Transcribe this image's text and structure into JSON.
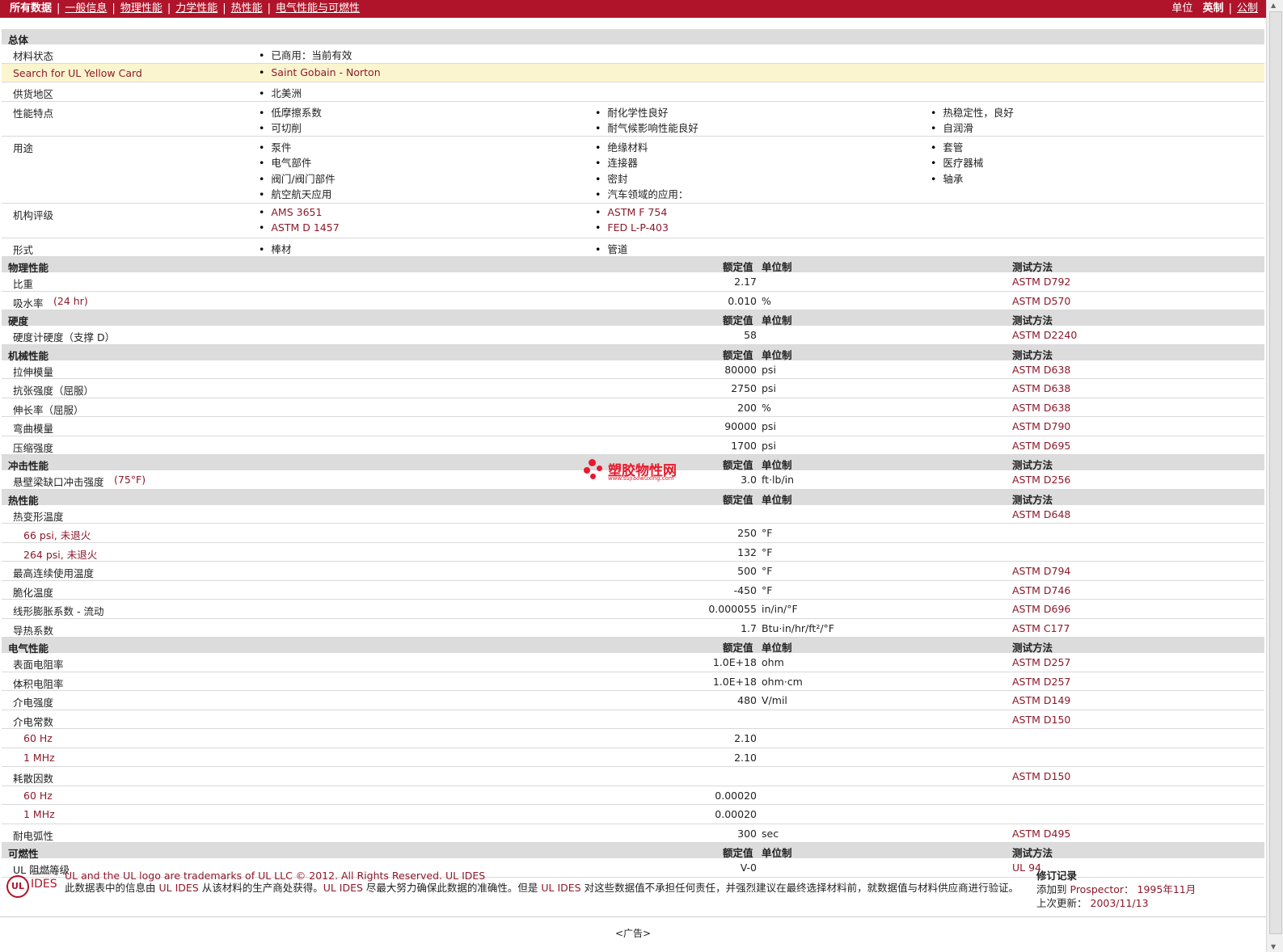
{
  "nav": {
    "current": "所有数据",
    "links": [
      "一般信息",
      "物理性能",
      "力学性能",
      "热性能",
      "电气性能与可燃性"
    ],
    "units_label": "单位",
    "units_current": "英制",
    "units_other": "公制"
  },
  "general": {
    "section_title": "总体",
    "material_status": {
      "label": "材料状态",
      "value": "已商用：当前有效"
    },
    "yellow_card": {
      "label": "Search for UL Yellow Card",
      "value": "Saint Gobain - Norton"
    },
    "region": {
      "label": "供货地区",
      "value": "北美洲"
    },
    "features": {
      "label": "性能特点",
      "col1": [
        "低摩擦系数",
        "可切削"
      ],
      "col2": [
        "耐化学性良好",
        "耐气候影响性能良好"
      ],
      "col3": [
        "热稳定性，良好",
        "自润滑"
      ]
    },
    "uses": {
      "label": "用途",
      "col1": [
        "泵件",
        "电气部件",
        "阀门/阀门部件",
        "航空航天应用"
      ],
      "col2": [
        "绝缘材料",
        "连接器",
        "密封",
        "汽车领域的应用："
      ],
      "col3": [
        "套管",
        "医疗器械",
        "轴承"
      ]
    },
    "agency": {
      "label": "机构评级",
      "col1": [
        "AMS 3651",
        "ASTM D 1457"
      ],
      "col2": [
        "ASTM F 754",
        "FED L-P-403"
      ]
    },
    "forms": {
      "label": "形式",
      "col1": [
        "棒材"
      ],
      "col2": [
        "管道"
      ]
    }
  },
  "headers": {
    "nominal": "额定值",
    "unit": "单位制",
    "test": "测试方法"
  },
  "sections": {
    "physical": "物理性能",
    "hardness": "硬度",
    "mechanical": "机械性能",
    "impact": "冲击性能",
    "thermal": "热性能",
    "electrical": "电气性能",
    "flammability": "可燃性"
  },
  "physical": [
    {
      "label": "比重",
      "cond": "",
      "value": "2.17",
      "unit": "",
      "test": "ASTM D792"
    },
    {
      "label": "吸水率",
      "cond": "(24 hr)",
      "value": "0.010",
      "unit": "%",
      "test": "ASTM D570"
    }
  ],
  "hardness": [
    {
      "label": "硬度计硬度（支撑 D）",
      "cond": "",
      "value": "58",
      "unit": "",
      "test": "ASTM D2240"
    }
  ],
  "mechanical": [
    {
      "label": "拉伸模量",
      "value": "80000",
      "unit": "psi",
      "test": "ASTM D638"
    },
    {
      "label": "抗张强度（屈服）",
      "value": "2750",
      "unit": "psi",
      "test": "ASTM D638"
    },
    {
      "label": "伸长率（屈服）",
      "value": "200",
      "unit": "%",
      "test": "ASTM D638"
    },
    {
      "label": "弯曲模量",
      "value": "90000",
      "unit": "psi",
      "test": "ASTM D790"
    },
    {
      "label": "压缩强度",
      "value": "1700",
      "unit": "psi",
      "test": "ASTM D695"
    }
  ],
  "impact": [
    {
      "label": "悬壁梁缺口冲击强度",
      "cond": "(75°F)",
      "value": "3.0",
      "unit": "ft·lb/in",
      "test": "ASTM D256"
    }
  ],
  "thermal": [
    {
      "label": "热变形温度",
      "indent": false,
      "value": "",
      "unit": "",
      "test": "ASTM D648"
    },
    {
      "label": "66 psi, 未退火",
      "indent": true,
      "value": "250",
      "unit": "°F",
      "test": ""
    },
    {
      "label": "264 psi, 未退火",
      "indent": true,
      "value": "132",
      "unit": "°F",
      "test": ""
    },
    {
      "label": "最高连续使用温度",
      "indent": false,
      "value": "500",
      "unit": "°F",
      "test": "ASTM D794"
    },
    {
      "label": "脆化温度",
      "indent": false,
      "value": "-450",
      "unit": "°F",
      "test": "ASTM D746"
    },
    {
      "label": "线形膨胀系数 - 流动",
      "indent": false,
      "value": "0.000055",
      "unit": "in/in/°F",
      "test": "ASTM D696"
    },
    {
      "label": "导热系数",
      "indent": false,
      "value": "1.7",
      "unit": "Btu·in/hr/ft²/°F",
      "test": "ASTM C177"
    }
  ],
  "electrical": [
    {
      "label": "表面电阻率",
      "indent": false,
      "value": "1.0E+18",
      "unit": "ohm",
      "test": "ASTM D257"
    },
    {
      "label": "体积电阻率",
      "indent": false,
      "value": "1.0E+18",
      "unit": "ohm·cm",
      "test": "ASTM D257"
    },
    {
      "label": "介电强度",
      "indent": false,
      "value": "480",
      "unit": "V/mil",
      "test": "ASTM D149"
    },
    {
      "label": "介电常数",
      "indent": false,
      "value": "",
      "unit": "",
      "test": "ASTM D150"
    },
    {
      "label": "60 Hz",
      "indent": true,
      "value": "2.10",
      "unit": "",
      "test": ""
    },
    {
      "label": "1 MHz",
      "indent": true,
      "value": "2.10",
      "unit": "",
      "test": ""
    },
    {
      "label": "耗散因数",
      "indent": false,
      "value": "",
      "unit": "",
      "test": "ASTM D150"
    },
    {
      "label": "60 Hz",
      "indent": true,
      "value": "0.00020",
      "unit": "",
      "test": ""
    },
    {
      "label": "1 MHz",
      "indent": true,
      "value": "0.00020",
      "unit": "",
      "test": ""
    },
    {
      "label": "耐电弧性",
      "indent": false,
      "value": "300",
      "unit": "sec",
      "test": "ASTM D495"
    }
  ],
  "flammability": [
    {
      "label": "UL 阻燃等级",
      "value": "V-0",
      "unit": "",
      "test": "UL 94"
    }
  ],
  "watermark": {
    "text": "塑胶物性网",
    "url": "www.sujiaowuxing.com"
  },
  "footer": {
    "logo_powered": "Powered by",
    "logo_ul": "UL",
    "logo_ides": "IDES",
    "trademark": "UL and the UL logo are trademarks of UL LLC © 2012. All Rights Reserved. UL IDES",
    "disclaimer_a": "此数据表中的信息由 ",
    "disclaimer_b": "UL IDES",
    "disclaimer_c": " 从该材料的生产商处获得。",
    "disclaimer_d": "UL IDES",
    "disclaimer_e": " 尽最大努力确保此数据的准确性。但是 ",
    "disclaimer_f": "UL IDES",
    "disclaimer_g": " 对这些数据值不承担任何责任，并强烈建议在最终选择材料前，就数据值与材料供应商进行验证。",
    "revision_title": "修订记录",
    "added_label": "添加到",
    "added_value": "Prospector：  1995年11月",
    "updated_label": "上次更新：",
    "updated_value": "2003/11/13"
  },
  "ad": "<广告>"
}
